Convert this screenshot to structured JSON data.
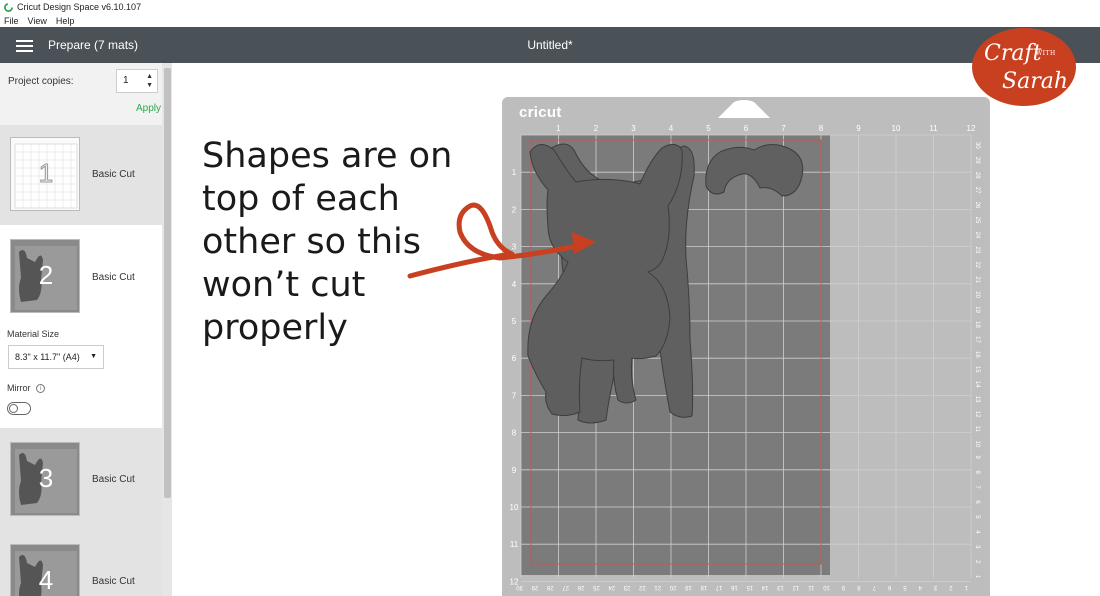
{
  "window": {
    "title": "Cricut Design Space  v6.10.107",
    "menu": [
      "File",
      "View",
      "Help"
    ]
  },
  "header": {
    "prepare_label": "Prepare (7 mats)",
    "doc_title": "Untitled*"
  },
  "logo": {
    "line1": "Craft",
    "line2": "WITH",
    "line3": "Sarah"
  },
  "sidebar": {
    "copies_label": "Project copies:",
    "copies_value": "1",
    "apply_label": "Apply",
    "mats": [
      {
        "number": "1",
        "label": "Basic Cut"
      },
      {
        "number": "2",
        "label": "Basic Cut"
      },
      {
        "number": "3",
        "label": "Basic Cut"
      },
      {
        "number": "4",
        "label": "Basic Cut"
      }
    ],
    "material_size_label": "Material Size",
    "material_size_value": "8.3\" x 11.7\" (A4)",
    "mirror_label": "Mirror"
  },
  "annotation": {
    "lines": [
      "Shapes are on",
      "top of each",
      "other so this",
      "won’t cut",
      "properly"
    ],
    "arrow_color": "#c8401f"
  },
  "mat": {
    "brand": "cricut",
    "top_ruler": [
      "1",
      "2",
      "3",
      "4",
      "5",
      "6",
      "7",
      "8",
      "9",
      "10",
      "11",
      "12"
    ],
    "left_ruler": [
      "1",
      "2",
      "3",
      "4",
      "5",
      "6",
      "7",
      "8",
      "9",
      "10",
      "11",
      "12"
    ],
    "right_ruler": [
      "30",
      "29",
      "28",
      "27",
      "26",
      "25",
      "24",
      "23",
      "22",
      "21",
      "20",
      "19",
      "18",
      "17",
      "16",
      "15",
      "14",
      "13",
      "12",
      "11",
      "10",
      "9",
      "8",
      "7",
      "6",
      "5",
      "4",
      "3",
      "2",
      "1"
    ],
    "bottom_ruler": [
      "30",
      "29",
      "28",
      "27",
      "26",
      "25",
      "24",
      "23",
      "22",
      "21",
      "20",
      "19",
      "18",
      "17",
      "16",
      "15",
      "14",
      "13",
      "12",
      "11",
      "10",
      "9",
      "8",
      "7",
      "6",
      "5",
      "4",
      "3",
      "2",
      "1"
    ]
  },
  "colors": {
    "header": "#4b5257",
    "accent": "#2fa84f",
    "shape": "#5f5f5f",
    "brand": "#c8401f"
  }
}
